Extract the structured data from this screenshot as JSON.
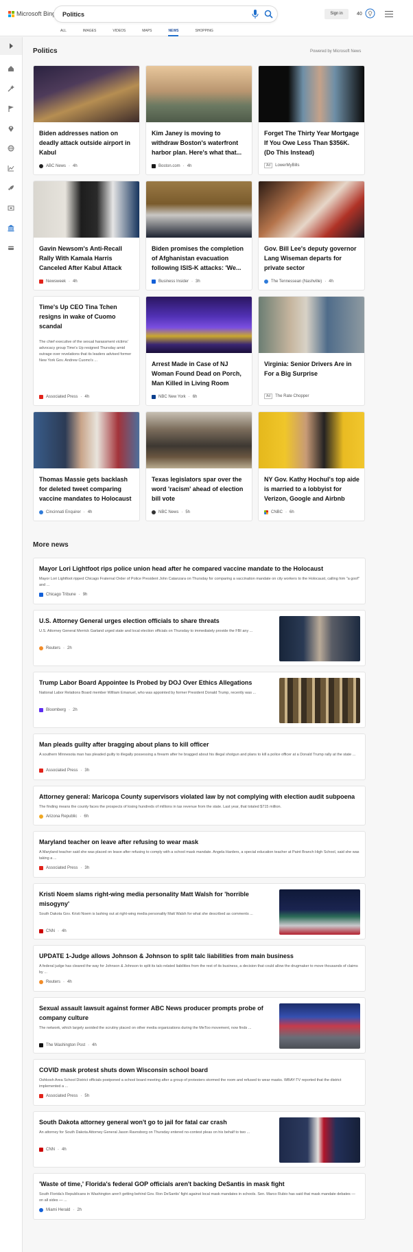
{
  "header": {
    "logo_text": "Microsoft Bing",
    "search_value": "Politics",
    "signin_label": "Sign in",
    "points": "40",
    "tabs": [
      "ALL",
      "IMAGES",
      "VIDEOS",
      "MAPS",
      "NEWS",
      "SHOPPING"
    ],
    "active_tab": "NEWS",
    "logo_colors": [
      "#f25022",
      "#7fba00",
      "#00a4ef",
      "#ffb900"
    ]
  },
  "politics": {
    "title": "Politics",
    "powered_by": "Powered by Microsoft News",
    "cards": [
      {
        "title": "Biden addresses nation on deadly attack outside airport in Kabul",
        "source": "ABC News",
        "time": "4h"
      },
      {
        "title": "Kim Janey is moving to withdraw Boston's waterfront harbor plan. Here's what that...",
        "source": "Boston.com",
        "time": "4h"
      },
      {
        "title": "Forget The Thirty Year Mortgage If You Owe Less Than $356K. (Do This Instead)",
        "ad": "Ad",
        "source": "LowerMyBills"
      },
      {
        "title": "Gavin Newsom's Anti-Recall Rally With Kamala Harris Canceled After Kabul Attack",
        "source": "Newsweek",
        "time": "4h"
      },
      {
        "title": "Biden promises the completion of Afghanistan evacuation following ISIS-K attacks: 'We...",
        "source": "Business Insider",
        "time": "3h"
      },
      {
        "title": "Gov. Bill Lee's deputy governor Lang Wiseman departs for private sector",
        "source": "The Tennessean (Nashville)",
        "time": "4h"
      },
      {
        "title": "Time's Up CEO Tina Tchen resigns in wake of Cuomo scandal",
        "description": "The chief executive of the sexual harassment victims' advocacy group Time's Up resigned Thursday amid outrage over revelations that its leaders advised former New York Gov. Andrew Cuomo's ...",
        "source": "Associated Press",
        "time": "4h"
      },
      {
        "title": "Arrest Made in Case of NJ Woman Found Dead on Porch, Man Killed in Living Room",
        "source": "NBC New York",
        "time": "6h"
      },
      {
        "title": "Virginia: Senior Drivers Are in For a Big Surprise",
        "ad": "Ad",
        "source": "The Rate Chopper"
      },
      {
        "title": "Thomas Massie gets backlash for deleted tweet comparing vaccine mandates to Holocaust",
        "source": "Cincinnati Enquirer",
        "time": "4h"
      },
      {
        "title": "Texas legislators spar over the word 'racism' ahead of election bill vote",
        "source": "NBC News",
        "time": "5h"
      },
      {
        "title": "NY Gov. Kathy Hochul's top aide is married to a lobbyist for Verizon, Google and Airbnb",
        "source": "CNBC",
        "time": "6h"
      }
    ]
  },
  "more_news": {
    "title": "More news",
    "items": [
      {
        "title": "Mayor Lori Lightfoot rips police union head after he compared vaccine mandate to the Holocaust",
        "description": "Mayor Lori Lightfoot ripped Chicago Fraternal Order of Police President John Catanzara on Thursday for comparing a vaccination mandate on city workers to the Holocaust, calling him \"a goof\" and ...",
        "source": "Chicago Tribune",
        "time": "9h"
      },
      {
        "title": "U.S. Attorney General urges election officials to share threats",
        "description": "U.S. Attorney General Merrick Garland urged state and local election officials on Thursday to immediately provide the FBI any ...",
        "source": "Reuters",
        "time": "2h"
      },
      {
        "title": "Trump Labor Board Appointee Is Probed by DOJ Over Ethics Allegations",
        "description": "National Labor Relations Board member William Emanuel, who was appointed by former President Donald Trump, recently was ...",
        "source": "Bloomberg",
        "time": "2h"
      },
      {
        "title": "Man pleads guilty after bragging about plans to kill officer",
        "description": "A southern Minnesota man has pleaded guilty to illegally possessing a firearm after he bragged about his illegal shotgun and plans to kill a police officer at a Donald Trump rally at the state ...",
        "source": "Associated Press",
        "time": "3h"
      },
      {
        "title": "Attorney general: Maricopa County supervisors violated law by not complying with election audit subpoena",
        "description": "The finding means the county faces the prospects of losing hundreds of millions in tax revenue from the state. Last year, that totaled $715 million.",
        "source": "Arizona Republic",
        "time": "6h"
      },
      {
        "title": "Maryland teacher on leave after refusing to wear mask",
        "description": "A Maryland teacher said she was placed on leave after refusing to comply with a school mask mandate. Angela Harders, a special education teacher at Paint Branch High School, said she was taking a ...",
        "source": "Associated Press",
        "time": "3h"
      },
      {
        "title": "Kristi Noem slams right-wing media personality Matt Walsh for 'horrible misogyny'",
        "description": "South Dakota Gov. Kristi Noem is lashing out at right-wing media personality Matt Walsh for what she described as comments ...",
        "source": "CNN",
        "time": "4h"
      },
      {
        "title": "UPDATE 1-Judge allows Johnson & Johnson to split talc liabilities from main business",
        "description": "A federal judge has cleared the way for Johnson & Johnson to split its talc-related liabilities from the rest of its business, a decision that could allow the drugmaker to move thousands of claims by ...",
        "source": "Reuters",
        "time": "4h"
      },
      {
        "title": "Sexual assault lawsuit against former ABC News producer prompts probe of company culture",
        "description": "The network, which largely avoided the scrutiny placed on other media organizations during the MeToo movement, now finds ...",
        "source": "The Washington Post",
        "time": "4h"
      },
      {
        "title": "COVID mask protest shuts down Wisconsin school board",
        "description": "Oshkosh Area School District officials postponed a school board meeting after a group of protesters stormed the room and refused to wear masks. WBAY-TV reported that the district implemented a ...",
        "source": "Associated Press",
        "time": "5h"
      },
      {
        "title": "South Dakota attorney general won't go to jail for fatal car crash",
        "description": "An attorney for South Dakota Attorney General Jason Ravnsborg on Thursday entered no-contest pleas on his behalf to two ...",
        "source": "CNN",
        "time": "4h"
      },
      {
        "title": "'Waste of time,' Florida's federal GOP officials aren't backing DeSantis in mask fight",
        "description": "South Florida's Republicans in Washington aren't getting behind Gov. Ron DeSantis' fight against local mask mandates in schools. Sen. Marco Rubio has said that mask mandate debates — on all sides — ...",
        "source": "Miami Herald",
        "time": "2h"
      }
    ]
  }
}
